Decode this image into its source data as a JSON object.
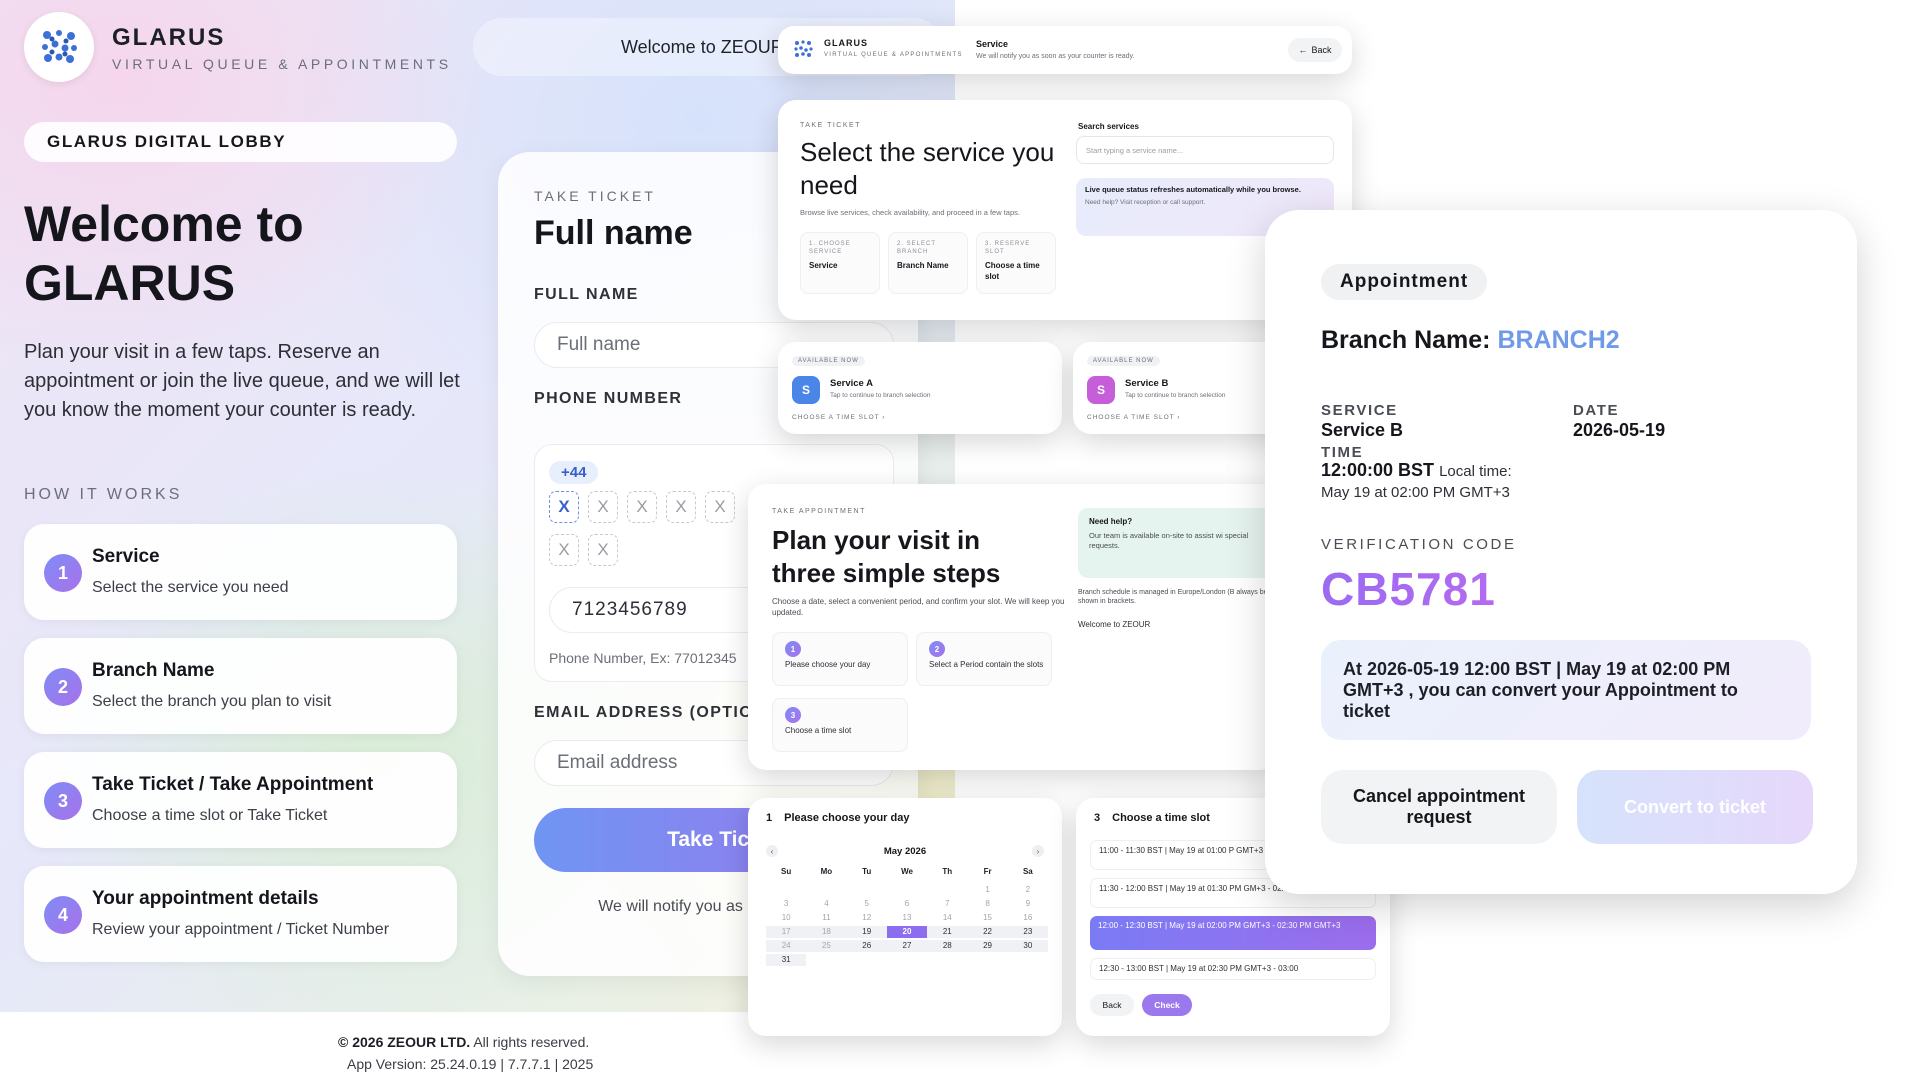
{
  "brand": {
    "name": "GLARUS",
    "subtitle": "VIRTUAL QUEUE & APPOINTMENTS"
  },
  "header": {
    "welcome": "Welcome to ZEOUR"
  },
  "lobby": {
    "badge": "GLARUS DIGITAL LOBBY",
    "title": "Welcome to GLARUS",
    "description": "Plan your visit in a few taps. Reserve an appointment or join the live queue, and we will let you know the moment your counter is ready.",
    "how_title": "HOW IT WORKS",
    "steps": [
      {
        "num": "1",
        "title": "Service",
        "desc": "Select the service you need"
      },
      {
        "num": "2",
        "title": "Branch Name",
        "desc": "Select the branch you plan to visit"
      },
      {
        "num": "3",
        "title": "Take Ticket / Take Appointment",
        "desc": "Choose a time slot or Take Ticket"
      },
      {
        "num": "4",
        "title": "Your appointment details",
        "desc": "Review your appointment / Ticket Number"
      }
    ]
  },
  "form": {
    "eyebrow": "TAKE TICKET",
    "title": "Full name",
    "fullname_label": "FULL NAME",
    "fullname_placeholder": "Full name",
    "phone_label": "PHONE NUMBER",
    "country_code": "+44",
    "digits": [
      "X",
      "X",
      "X",
      "X",
      "X",
      "X",
      "X"
    ],
    "phone_value": "7123456789",
    "phone_hint": "Phone Number, Ex: 77012345",
    "email_label": "EMAIL ADDRESS (OPTION",
    "email_placeholder": "Email address",
    "submit": "Take Tick",
    "note": "We will notify you as soon ready."
  },
  "footer": {
    "company": "© 2026 ZEOUR LTD.",
    "rights": "All rights reserved.",
    "version": "App Version: 25.24.0.19 | 7.7.7.1 | 2025"
  },
  "topbar_shot": {
    "brand": "GLARUS",
    "subtitle": "VIRTUAL QUEUE & APPOINTMENTS",
    "service": "Service",
    "notify": "We will notify you as soon as your counter is ready.",
    "back": "Back"
  },
  "service_shot": {
    "eyebrow": "TAKE TICKET",
    "title": "Select the service you need",
    "desc": "Browse live services, check availability, and proceed in a few taps.",
    "steps": [
      {
        "label": "1. CHOOSE SERVICE",
        "value": "Service"
      },
      {
        "label": "2. SELECT BRANCH",
        "value": "Branch Name"
      },
      {
        "label": "3. RESERVE SLOT",
        "value": "Choose a time slot"
      }
    ],
    "search_label": "Search services",
    "search_placeholder": "Start typing a service name...",
    "info_title": "Live queue status refreshes automatically while you browse.",
    "info_sub": "Need help? Visit reception or call support."
  },
  "tiles": [
    {
      "eyebrow": "AVAILABLE NOW",
      "letter": "S",
      "name": "Service A",
      "sub": "Tap to continue to branch selection",
      "cta": "CHOOSE A TIME SLOT ›",
      "color": "#4a86e8"
    },
    {
      "eyebrow": "AVAILABLE NOW",
      "letter": "S",
      "name": "Service B",
      "sub": "Tap to continue to branch selection",
      "cta": "CHOOSE A TIME SLOT ›",
      "color": "#c55ed8"
    }
  ],
  "plan_shot": {
    "eyebrow": "TAKE APPOINTMENT",
    "title": "Plan your visit in three simple steps",
    "desc": "Choose a date, select a convenient period, and confirm your slot. We will keep you updated.",
    "steps": [
      {
        "num": "1",
        "text": "Please choose your day"
      },
      {
        "num": "2",
        "text": "Select a Period contain the slots"
      },
      {
        "num": "3",
        "text": "Choose a time slot"
      }
    ],
    "help_title": "Need help?",
    "help_text": "Our team is available on-site to assist wi special requests.",
    "schedule_note": "Branch schedule is managed in Europe/London (B always be shown in brackets.",
    "welcome": "Welcome to ZEOUR"
  },
  "calendar_shot": {
    "step": "1",
    "title": "Please choose your day",
    "month": "May 2026",
    "weekdays": [
      "Su",
      "Mo",
      "Tu",
      "We",
      "Th",
      "Fr",
      "Sa"
    ],
    "days": [
      "",
      "",
      "",
      "",
      "",
      "1",
      "2",
      "3",
      "4",
      "5",
      "6",
      "7",
      "8",
      "9",
      "10",
      "11",
      "12",
      "13",
      "14",
      "15",
      "16",
      "17",
      "18",
      "19",
      "20",
      "21",
      "22",
      "23",
      "24",
      "25",
      "26",
      "27",
      "28",
      "29",
      "30",
      "31",
      "",
      "",
      "",
      "",
      "",
      ""
    ],
    "selected": "20"
  },
  "slots_shot": {
    "step": "3",
    "title": "Choose a time slot",
    "slots": [
      "11:00 - 11:30 BST | May 19 at 01:00 P GMT+3",
      "11:30 - 12:00 BST | May 19 at 01:30 PM GM+3 - 02:00 GMT+3",
      "12:00 - 12:30 BST | May 19 at 02:00 PM GMT+3 - 02:30 PM GMT+3",
      "12:30 - 13:00 BST | May 19 at 02:30 PM GMT+3 - 03:00"
    ],
    "selected_index": 2,
    "back": "Back",
    "check": "Check"
  },
  "appointment": {
    "badge": "Appointment",
    "branch_label": "Branch Name:",
    "branch_value": "BRANCH2",
    "service_label": "SERVICE",
    "service_value": "Service B",
    "date_label": "DATE",
    "date_value": "2026-05-19",
    "time_label": "TIME",
    "time_value": "12:00:00 BST",
    "local_label": "Local time:",
    "local_value": "May 19 at 02:00 PM GMT+3",
    "code_label": "VERIFICATION CODE",
    "code": "CB5781",
    "message": "At 2026-05-19 12:00 BST | May 19 at 02:00 PM GMT+3 , you can convert your Appointment to ticket",
    "cancel": "Cancel appointment request",
    "convert": "Convert to ticket"
  }
}
